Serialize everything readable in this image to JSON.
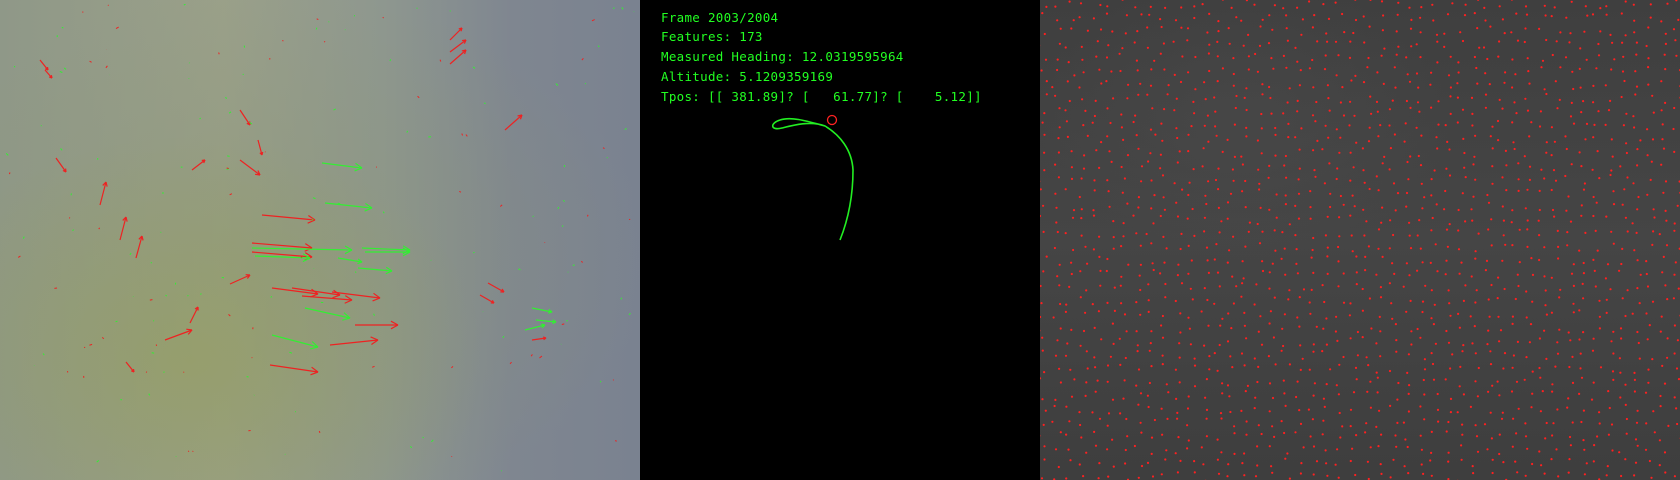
{
  "hud": {
    "frame": "Frame 2003/2004",
    "features": "Features: 173",
    "heading": "Measured Heading: 12.0319595964",
    "altitude": "Altitude: 5.1209359169",
    "tpos": "Tpos: [[ 381.89]? [   61.77]? [    5.12]]"
  },
  "colors": {
    "hud_text": "#22ff22",
    "trajectory": "#22ee22",
    "marker": "#ff2222",
    "flow_good": "#33ee33",
    "flow_outlier": "#ee2222",
    "feature_point": "#ff2020"
  },
  "panels": {
    "left": "optical-flow-view",
    "center": "trajectory-view",
    "right": "feature-detection-view"
  }
}
